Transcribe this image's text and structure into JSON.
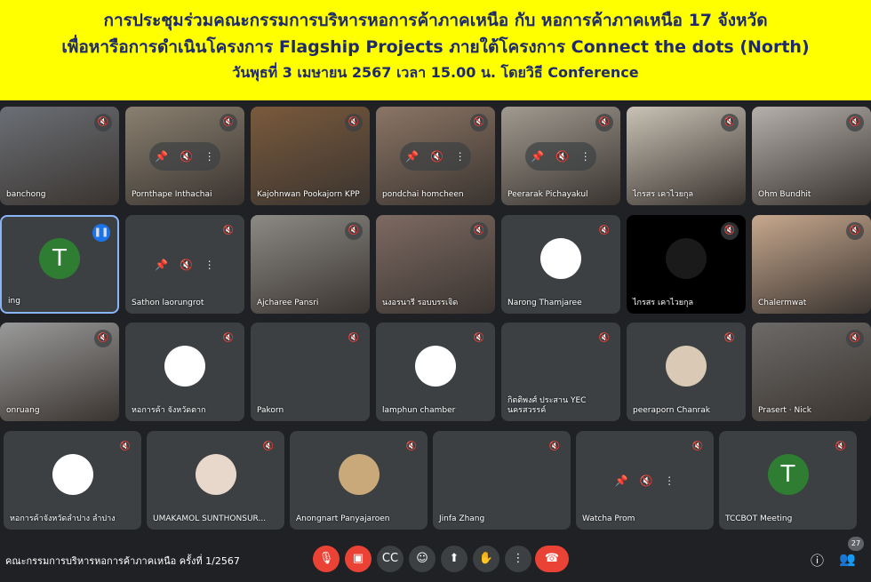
{
  "banner": {
    "line1": "การประชุมร่วมคณะกรรมการบริหารหอการค้าภาคเหนือ กับ หอการค้าภาคเหนือ 17 จังหวัด",
    "line2": "เพื่อหารือการดำเนินโครงการ Flagship Projects ภายใต้โครงการ Connect the dots (North)",
    "line3": "วันพุธที่ 3 เมษายน 2567 เวลา 15.00 น. โดยวิธี Conference"
  },
  "tiles": [
    {
      "name": "banchong",
      "bg": "#6b6f75",
      "avatar": ""
    },
    {
      "name": "Pornthape Inthachai",
      "bg": "#8a8070"
    },
    {
      "name": "Kajohnwan Pookajorn KPP",
      "bg": "#7a5a3c"
    },
    {
      "name": "pondchai homcheen",
      "bg": "#8b7565"
    },
    {
      "name": "Peerarak Pichayakul",
      "bg": "#a09a90"
    },
    {
      "name": "ไกรสร เคาไวยกุล",
      "bg": "#c9c2b5"
    },
    {
      "name": "Ohm Bundhit",
      "bg": "#b5b0aa"
    },
    {
      "name": "ing",
      "bg": "#3c4043",
      "avatar": "T",
      "avatar_color": "#2e7d32"
    },
    {
      "name": "Sathon laorungrot",
      "bg": "#3c4043"
    },
    {
      "name": "Ajcharee Pansri",
      "bg": "#8c8a85"
    },
    {
      "name": "นงอรนารี รอบบรรเจิด",
      "bg": "#7d6a62"
    },
    {
      "name": "Narong Thamjaree",
      "bg": "#3c4043",
      "avatar": "",
      "avatar_color": "#ffffff"
    },
    {
      "name": "ไกรสร เคาไวยกุล",
      "bg": "#000000",
      "avatar": "",
      "avatar_color": "#1a1a1a"
    },
    {
      "name": "Chalermwat",
      "bg": "#c7a88e"
    },
    {
      "name": "onruang",
      "bg": "#9a9a9a"
    },
    {
      "name": "หอการค้า จังหวัดตาก",
      "bg": "#3c4043",
      "avatar": "",
      "avatar_color": "#ffffff"
    },
    {
      "name": "Pakorn",
      "bg": "#3c4043"
    },
    {
      "name": "lamphun chamber",
      "bg": "#3c4043",
      "avatar": "",
      "avatar_color": "#ffffff"
    },
    {
      "name": "กิตติพงศ์ ประสาน YEC นครสวรรค์",
      "bg": "#3c4043"
    },
    {
      "name": "peeraporn Chanrak",
      "bg": "#3c4043",
      "avatar": "",
      "avatar_color": "#d9c9b5"
    },
    {
      "name": "Prasert · Nick",
      "bg": "#6c6a68"
    },
    {
      "name": "หอการค้าจังหวัดลำปาง ลำปาง",
      "bg": "#3c4043",
      "avatar": "",
      "avatar_color": "#ffffff"
    },
    {
      "name": "UMAKAMOL SUNTHONSUR...",
      "bg": "#3c4043",
      "avatar": "",
      "avatar_color": "#e8d8cc"
    },
    {
      "name": "Anongnart Panyajaroen",
      "bg": "#3c4043",
      "avatar": "",
      "avatar_color": "#c9a97a"
    },
    {
      "name": "Jinfa Zhang",
      "bg": "#3c4043"
    },
    {
      "name": "Watcha Prom",
      "bg": "#3c4043"
    },
    {
      "name": "TCCBOT Meeting",
      "bg": "#3c4043",
      "avatar": "T",
      "avatar_color": "#2e7d32"
    }
  ],
  "bottom": {
    "meeting_name": "คณะกรรมการบริหารหอการค้าภาคเหนือ ครั้งที่ 1/2567",
    "participant_count": "27"
  },
  "colors": {
    "banner": "#ffff00",
    "banner_text": "#1f2a6b",
    "end_call": "#ea4335"
  }
}
